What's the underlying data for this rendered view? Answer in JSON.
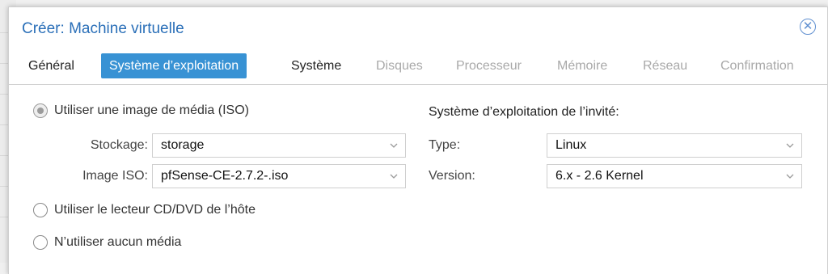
{
  "dialog": {
    "title": "Créer: Machine virtuelle"
  },
  "tabs": [
    {
      "label": "Général",
      "state": "normal"
    },
    {
      "label": "Système d’exploitation",
      "state": "active"
    },
    {
      "label": "Système",
      "state": "normal"
    },
    {
      "label": "Disques",
      "state": "disabled"
    },
    {
      "label": "Processeur",
      "state": "disabled"
    },
    {
      "label": "Mémoire",
      "state": "disabled"
    },
    {
      "label": "Réseau",
      "state": "disabled"
    },
    {
      "label": "Confirmation",
      "state": "disabled"
    }
  ],
  "media": {
    "option_iso": "Utiliser une image de média (ISO)",
    "storage_label": "Stockage:",
    "storage_value": "storage",
    "iso_label": "Image ISO:",
    "iso_value": "pfSense-CE-2.7.2-.iso",
    "option_cdrom": "Utiliser le lecteur CD/DVD de l’hôte",
    "option_none": "N’utiliser aucun média",
    "selected": "iso"
  },
  "guest_os": {
    "section_title": "Système d’exploitation de l’invité:",
    "type_label": "Type:",
    "type_value": "Linux",
    "version_label": "Version:",
    "version_value": "6.x - 2.6 Kernel"
  },
  "colors": {
    "accent": "#3892d4",
    "title": "#2a6fb8"
  }
}
